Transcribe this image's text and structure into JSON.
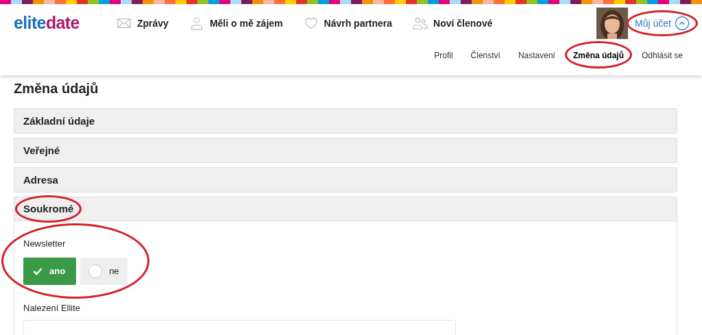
{
  "header": {
    "logo": {
      "part1": "elite",
      "part2": "date"
    },
    "nav": [
      {
        "label": "Zprávy",
        "kind": "mail"
      },
      {
        "label": "Měli o mě zájem",
        "kind": "person"
      },
      {
        "label": "Návrh partnera",
        "kind": "heart"
      },
      {
        "label": "Noví členové",
        "kind": "people"
      }
    ],
    "account": {
      "label": "Můj účet",
      "expanded": true,
      "circled": true
    },
    "subnav": [
      {
        "label": "Profil",
        "selected": false,
        "circled": false
      },
      {
        "label": "Členství",
        "selected": false,
        "circled": false
      },
      {
        "label": "Nastavení",
        "selected": false,
        "circled": false
      },
      {
        "label": "Změna údajů",
        "selected": true,
        "circled": true
      },
      {
        "label": "Odhlásit se",
        "selected": false,
        "circled": false
      }
    ]
  },
  "page_title": "Změna údajů",
  "sections": [
    {
      "title": "Základní údaje",
      "expanded": false,
      "circled": false
    },
    {
      "title": "Veřejné",
      "expanded": false,
      "circled": false
    },
    {
      "title": "Adresa",
      "expanded": false,
      "circled": false
    },
    {
      "title": "Soukromé",
      "expanded": true,
      "circled": true
    }
  ],
  "newsletter": {
    "label": "Newsletter",
    "circled": true,
    "options": [
      {
        "label": "ano",
        "selected": true
      },
      {
        "label": "ne",
        "selected": false
      }
    ]
  },
  "found": {
    "label": "Nalezení Ellite"
  }
}
